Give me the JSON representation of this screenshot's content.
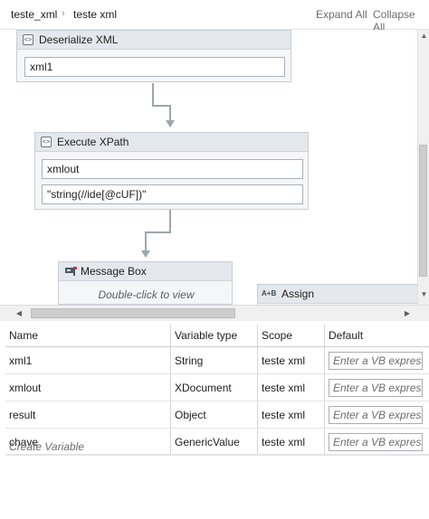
{
  "breadcrumb": [
    "teste_xml",
    "teste xml"
  ],
  "toolbar": {
    "expand_all": "Expand All",
    "collapse_all": "Collapse All"
  },
  "activities": {
    "deserialize": {
      "title": "Deserialize XML",
      "input": "xml1",
      "icon": "xml-activity-icon"
    },
    "xpath": {
      "title": "Execute XPath",
      "input1": "xmlout",
      "input2": "\"string(//ide[@cUF])\"",
      "icon": "xml-activity-icon"
    },
    "msgbox": {
      "title": "Message Box",
      "hint": "Double-click to view",
      "icon": "message-box-icon"
    },
    "assign": {
      "title": "Assign",
      "icon_text": "A+B"
    }
  },
  "variables": {
    "columns": [
      "Name",
      "Variable type",
      "Scope",
      "Default"
    ],
    "rows": [
      {
        "name": "xml1",
        "type": "String",
        "scope": "teste xml",
        "default_placeholder": "Enter a VB expression"
      },
      {
        "name": "xmlout",
        "type": "XDocument",
        "scope": "teste xml",
        "default_placeholder": "Enter a VB expression"
      },
      {
        "name": "result",
        "type": "Object",
        "scope": "teste xml",
        "default_placeholder": "Enter a VB expression"
      },
      {
        "name": "chave",
        "type": "GenericValue",
        "scope": "teste xml",
        "default_placeholder": "Enter a VB expression"
      }
    ],
    "create": "Create Variable"
  },
  "colors": {
    "activity_header": "#e4e8ec",
    "connector": "#9da6ae",
    "field_border": "#a9b1ba"
  }
}
